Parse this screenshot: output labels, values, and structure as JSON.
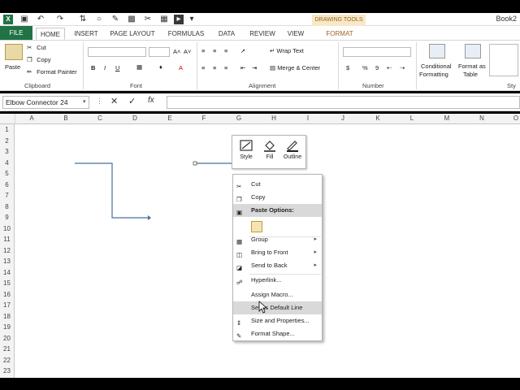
{
  "qat": {
    "icons": [
      "excel-logo-icon",
      "save-icon",
      "undo-icon",
      "redo-icon",
      "sort-icon",
      "shape-icon",
      "pen-icon",
      "camera-icon",
      "clear-icon",
      "scissors-icon",
      "grid-icon",
      "pointer-icon",
      "customize-icon"
    ]
  },
  "drawing_tools": "DRAWING TOOLS",
  "book_title": "Book2",
  "tabs": {
    "file": "FILE",
    "home": "HOME",
    "insert": "INSERT",
    "page_layout": "PAGE LAYOUT",
    "formulas": "FORMULAS",
    "data": "DATA",
    "review": "REVIEW",
    "view": "VIEW",
    "format": "FORMAT"
  },
  "ribbon": {
    "clipboard": {
      "paste": "Paste",
      "cut": "Cut",
      "copy": "Copy",
      "format_painter": "Format Painter",
      "label": "Clipboard"
    },
    "font": {
      "bold": "B",
      "italic": "I",
      "underline": "U",
      "grow": "A˄",
      "shrink": "A˅",
      "font_color": "A",
      "label": "Font"
    },
    "alignment": {
      "wrap_text": "Wrap Text",
      "merge_center": "Merge & Center",
      "label": "Alignment"
    },
    "number": {
      "currency": "$",
      "percent": "%",
      "comma": "9",
      "label": "Number"
    },
    "styles": {
      "conditional_formatting": "Conditional",
      "conditional_formatting_2": "Formatting",
      "format_as_table": "Format as",
      "format_as_table_2": "Table",
      "cell_styles": "Sty"
    }
  },
  "formula_bar": {
    "name_box": "Elbow Connector 24",
    "cancel": "✕",
    "enter": "✓",
    "fx": "fx",
    "value": ""
  },
  "columns": [
    "A",
    "B",
    "C",
    "D",
    "E",
    "F",
    "G",
    "H",
    "I",
    "J",
    "K",
    "L",
    "M",
    "N",
    "O"
  ],
  "rows": [
    "1",
    "2",
    "3",
    "4",
    "5",
    "6",
    "7",
    "8",
    "9",
    "10",
    "11",
    "12",
    "13",
    "14",
    "15",
    "16",
    "17",
    "18",
    "19",
    "20",
    "21",
    "22",
    "23"
  ],
  "mini_toolbar": {
    "style": "Style",
    "fill": "Fill",
    "outline": "Outline"
  },
  "context_menu": {
    "cut": "Cut",
    "copy": "Copy",
    "paste_options": "Paste Options:",
    "group": "Group",
    "bring_to_front": "Bring to Front",
    "send_to_back": "Send to Back",
    "hyperlink": "Hyperlink...",
    "assign_macro": "Assign Macro...",
    "set_default_line": "Set as Default Line",
    "size_properties": "Size and Properties...",
    "format_shape": "Format Shape..."
  },
  "colors": {
    "file_tab": "#217346",
    "connector_line": "#4a6f9e",
    "highlight": "#d9d9d9"
  }
}
